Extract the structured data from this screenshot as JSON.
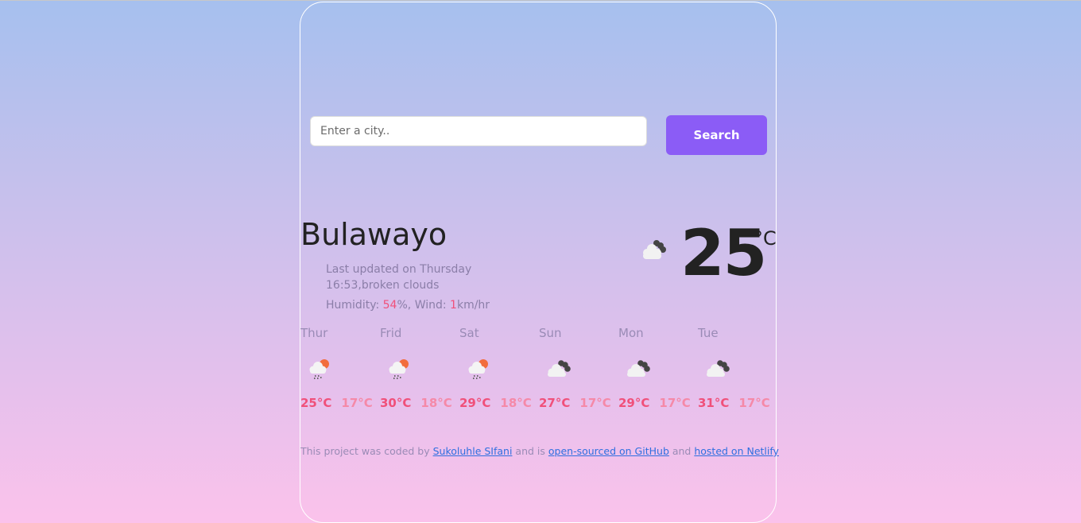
{
  "search": {
    "placeholder": "Enter a city..",
    "value": "",
    "button_label": "Search"
  },
  "current": {
    "city": "Bulawayo",
    "updated_prefix": "Last updated on",
    "updated_day": "Thursday",
    "updated_time": "16:53",
    "description": "broken clouds",
    "humidity_label": "Humidity:",
    "humidity_value": "54",
    "humidity_unit": "%,",
    "wind_label": "Wind:",
    "wind_value": "1",
    "wind_unit": "km/hr",
    "temperature": "25",
    "unit": "°C",
    "icon": "broken-clouds-icon"
  },
  "forecast": [
    {
      "day": "Thur",
      "icon": "rain-sun-icon",
      "max": "25°C",
      "min": "17°C"
    },
    {
      "day": "Frid",
      "icon": "rain-sun-icon",
      "max": "30°C",
      "min": "18°C"
    },
    {
      "day": "Sat",
      "icon": "rain-sun-icon",
      "max": "29°C",
      "min": "18°C"
    },
    {
      "day": "Sun",
      "icon": "broken-clouds-icon",
      "max": "27°C",
      "min": "17°C"
    },
    {
      "day": "Mon",
      "icon": "broken-clouds-icon",
      "max": "29°C",
      "min": "17°C"
    },
    {
      "day": "Tue",
      "icon": "broken-clouds-icon",
      "max": "31°C",
      "min": "17°C"
    }
  ],
  "footer": {
    "text1": "This project was coded by ",
    "author_link": "Sukoluhle SIfani",
    "text2": " and is ",
    "github_link": "open-sourced on GitHub",
    "text3": " and ",
    "netlify_link": "hosted on Netlify"
  },
  "colors": {
    "accent": "#8b5cf6",
    "highlight": "#f0507a",
    "min_temp": "#f589a8",
    "link": "#2f6fe0"
  }
}
